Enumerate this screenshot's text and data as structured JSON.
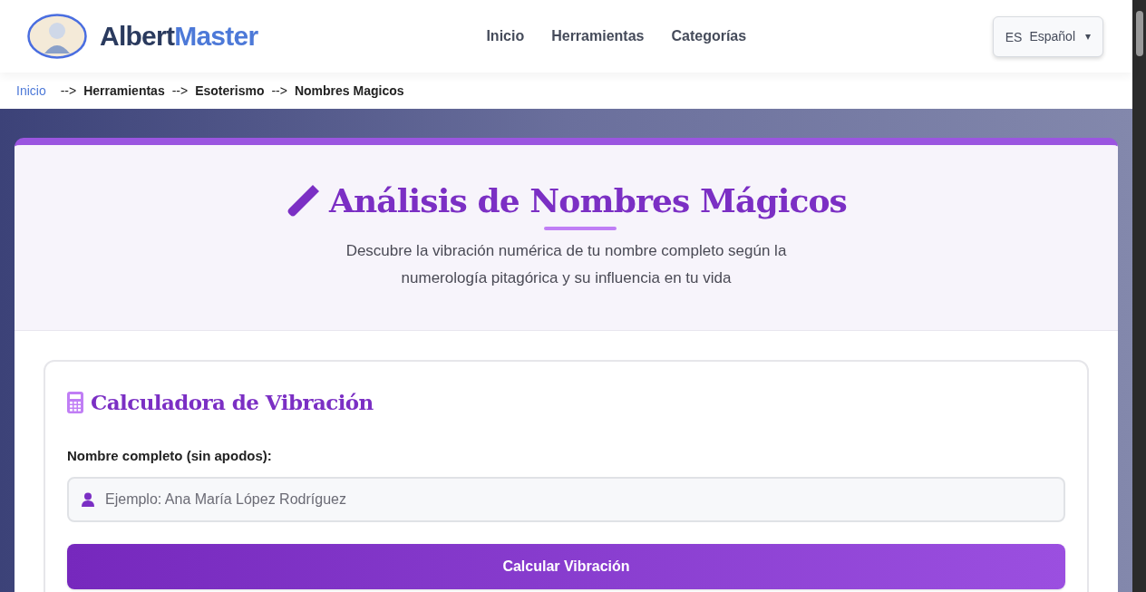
{
  "header": {
    "brand": {
      "first": "Albert",
      "second": "Master"
    },
    "nav": [
      "Inicio",
      "Herramientas",
      "Categorías"
    ],
    "language": {
      "code": "ES",
      "label": "Español",
      "caret": "▾"
    }
  },
  "breadcrumb": {
    "separator": "-->",
    "items": [
      {
        "label": "Inicio",
        "kind": "link"
      },
      {
        "label": "Herramientas",
        "kind": "text"
      },
      {
        "label": "Esoterismo",
        "kind": "text"
      },
      {
        "label": "Nombres Magicos",
        "kind": "text"
      }
    ]
  },
  "hero": {
    "title": "Análisis de Nombres Mágicos",
    "subtitle": "Descubre la vibración numérica de tu nombre completo según la numerología pitagórica y su influencia en tu vida"
  },
  "calculator": {
    "title": "Calculadora de Vibración",
    "field_label": "Nombre completo (sin apodos):",
    "placeholder": "Ejemplo: Ana María López Rodríguez",
    "button": "Calcular Vibración"
  }
}
